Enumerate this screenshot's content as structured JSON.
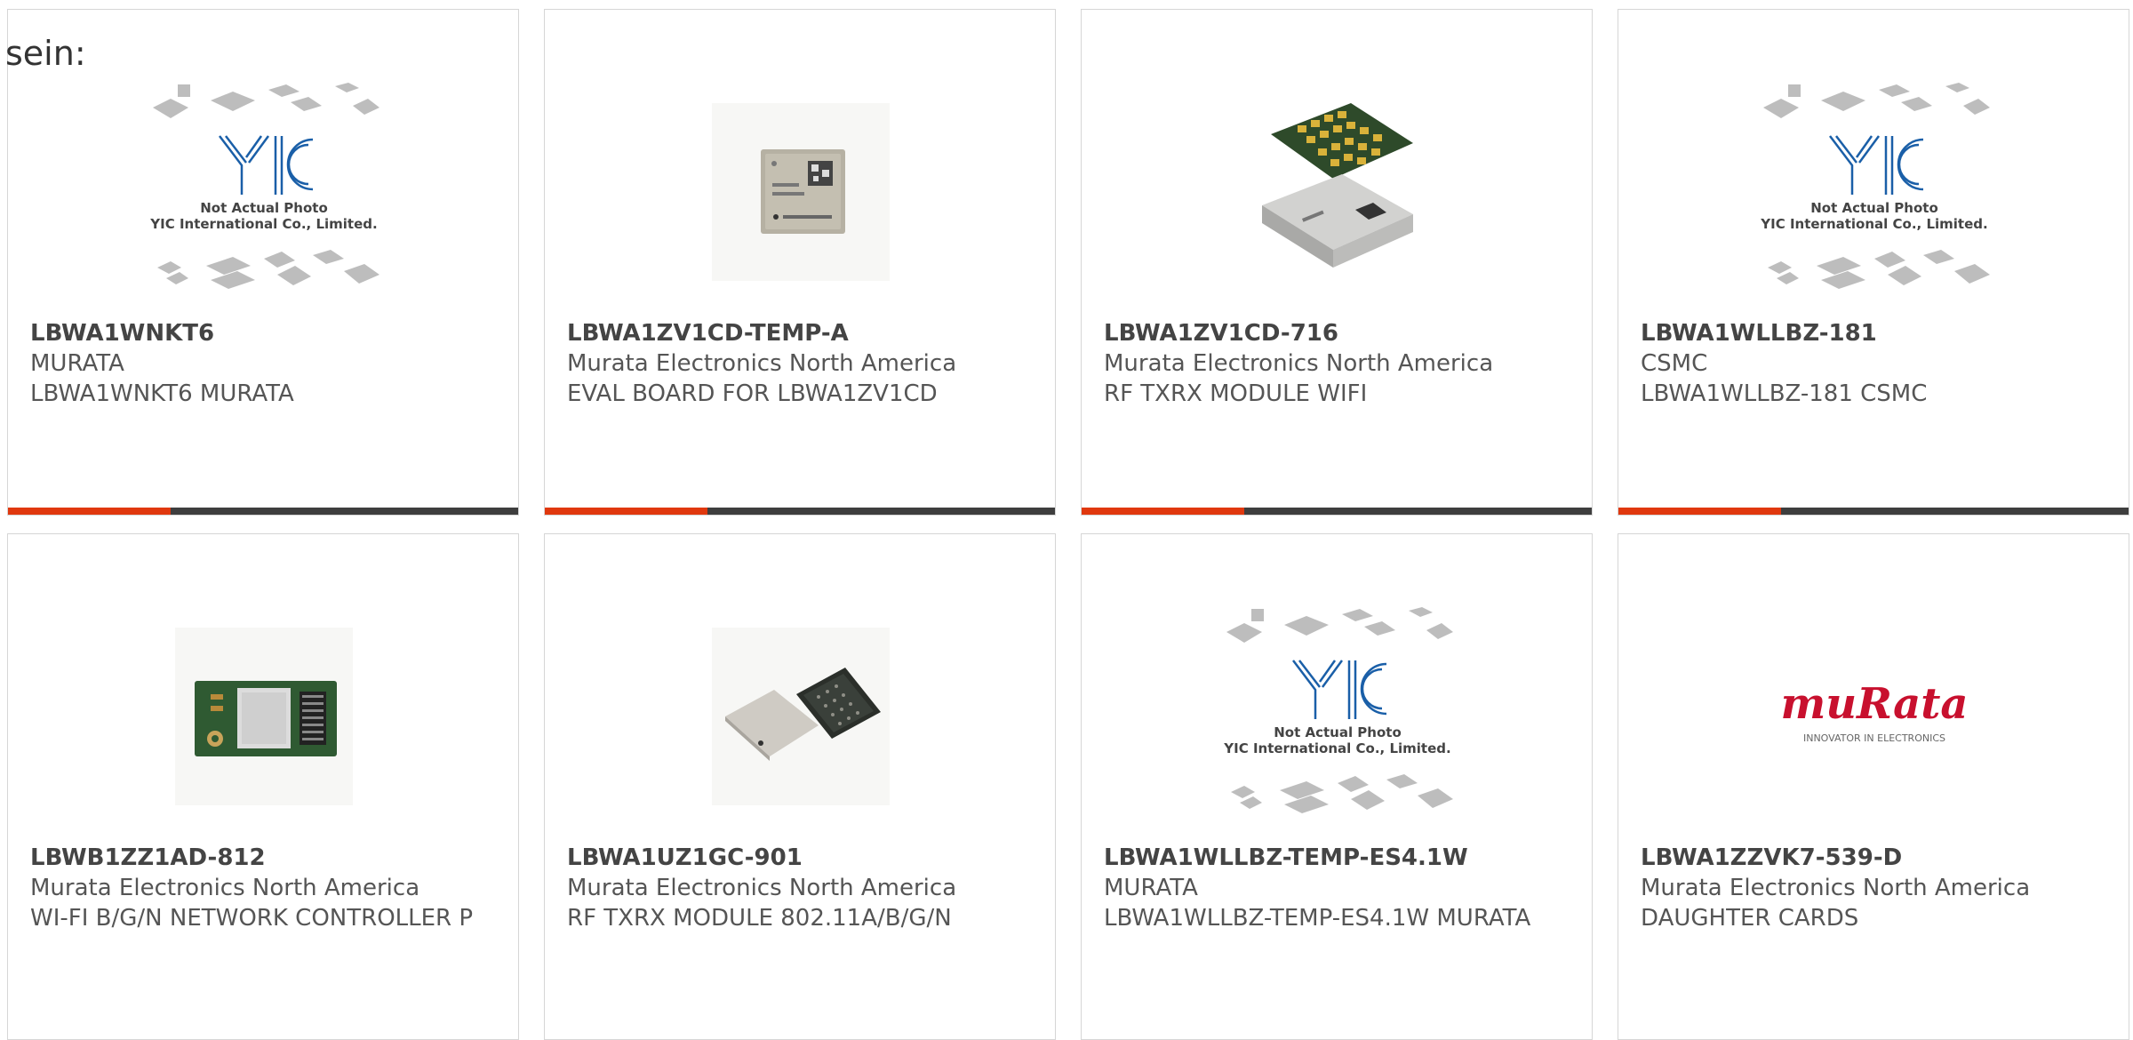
{
  "intro_text": "sein:",
  "colors": {
    "accent": "#e0380e",
    "bar": "#3e3e3e",
    "border": "#d6d6d6",
    "yic_blue": "#1a5fa8",
    "murata_red": "#c8102e"
  },
  "placeholder": {
    "line1": "Not Actual Photo",
    "line2": "YIC International Co., Limited.",
    "logo": "YIC"
  },
  "murata_logo": {
    "brand": "muRata",
    "tagline": "INNOVATOR IN ELECTRONICS"
  },
  "products": [
    {
      "part": "LBWA1WNKT6",
      "maker": "MURATA",
      "desc": "LBWA1WNKT6 MURATA",
      "image": "not-actual-photo-placeholder"
    },
    {
      "part": "LBWA1ZV1CD-TEMP-A",
      "maker": "Murata Electronics North America",
      "desc": "EVAL BOARD FOR LBWA1ZV1CD",
      "image": "module-chip-photo"
    },
    {
      "part": "LBWA1ZV1CD-716",
      "maker": "Murata Electronics North America",
      "desc": "RF TXRX MODULE WIFI",
      "image": "stacked-module-photo"
    },
    {
      "part": "LBWA1WLLBZ-181",
      "maker": "CSMC",
      "desc": "LBWA1WLLBZ-181 CSMC",
      "image": "not-actual-photo-placeholder"
    },
    {
      "part": "LBWB1ZZ1AD-812",
      "maker": "Murata Electronics North America",
      "desc": "WI-FI B/G/N NETWORK CONTROLLER P",
      "image": "green-pcb-photo"
    },
    {
      "part": "LBWA1UZ1GC-901",
      "maker": "Murata Electronics North America",
      "desc": "RF TXRX MODULE 802.11A/B/G/N",
      "image": "two-chips-photo"
    },
    {
      "part": "LBWA1WLLBZ-TEMP-ES4.1W",
      "maker": "MURATA",
      "desc": "LBWA1WLLBZ-TEMP-ES4.1W MURATA",
      "image": "not-actual-photo-placeholder"
    },
    {
      "part": "LBWA1ZZVK7-539-D",
      "maker": "Murata Electronics North America",
      "desc": "DAUGHTER CARDS",
      "image": "murata-logo"
    }
  ]
}
